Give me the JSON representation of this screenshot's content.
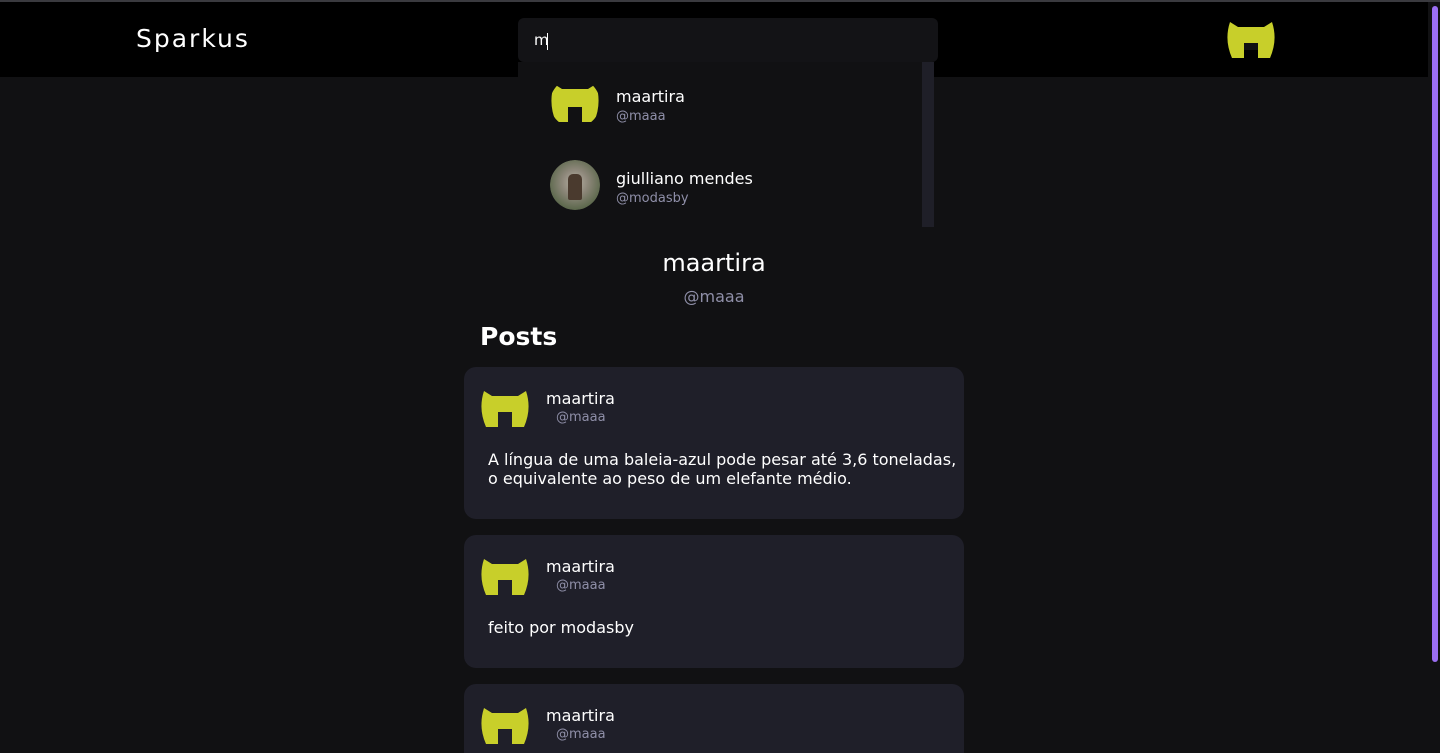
{
  "app": {
    "brand": "Sparkus"
  },
  "search": {
    "value": "m",
    "placeholder": ""
  },
  "results": [
    {
      "name": "maartira",
      "handle": "@maaa",
      "avatar": "logo-avatar-icon"
    },
    {
      "name": "giulliano mendes",
      "handle": "@modasby",
      "avatar": "photo-avatar"
    }
  ],
  "profile": {
    "name": "maartira",
    "handle": "@maaa"
  },
  "posts_section": {
    "title": "Posts"
  },
  "posts": [
    {
      "name": "maartira",
      "handle": "@maaa",
      "text": "A língua de uma baleia-azul pode pesar até 3,6 toneladas, o equivalente ao peso de um elefante médio."
    },
    {
      "name": "maartira",
      "handle": "@maaa",
      "text": "feito por modasby"
    },
    {
      "name": "maartira",
      "handle": "@maaa",
      "text": ""
    }
  ],
  "colors": {
    "accent": "#c8cf2a",
    "scrollbar": "#9b6ef3",
    "card": "#1f1f29",
    "muted": "#8f8fa8"
  }
}
